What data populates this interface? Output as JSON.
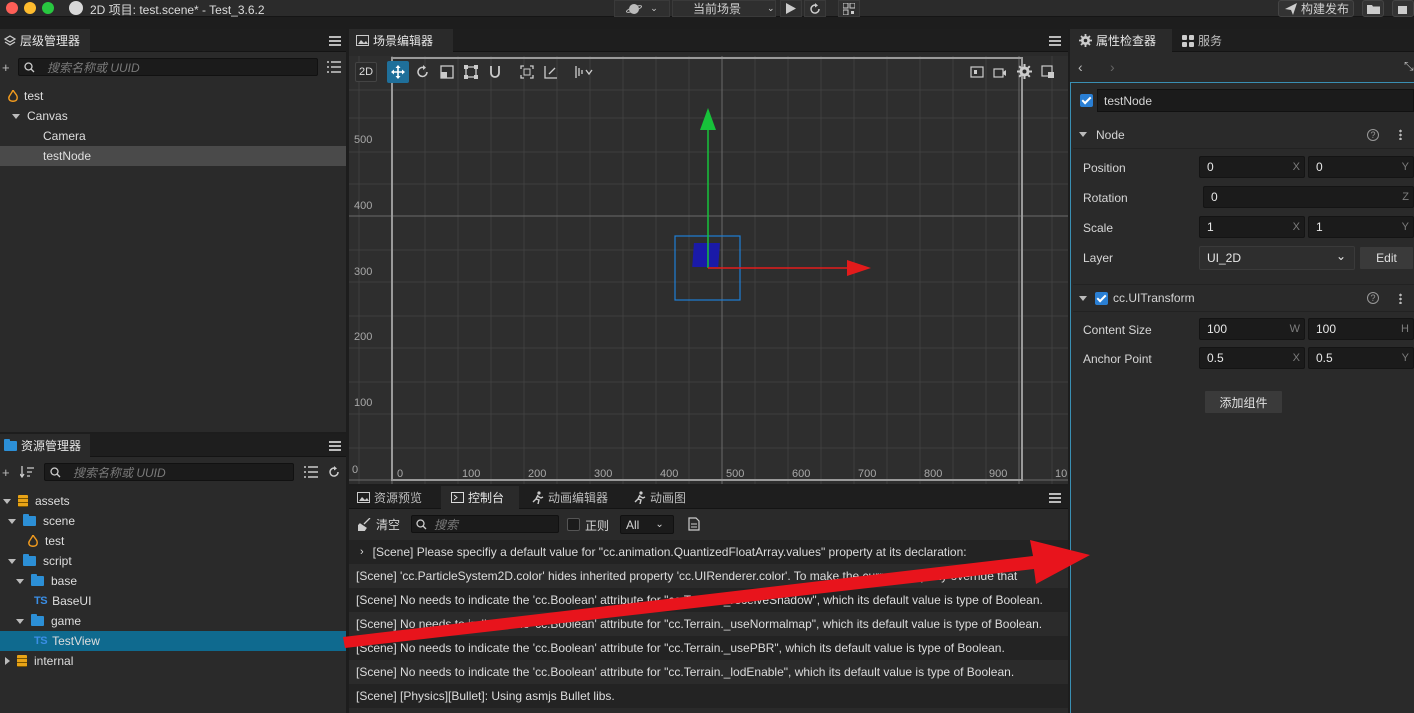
{
  "titlebar": {
    "title": "2D 项目: test.scene* - Test_3.6.2",
    "scene_select": "当前场景",
    "build_label": "构建发布"
  },
  "hierarchy": {
    "tab": "层级管理器",
    "search_placeholder": "搜索名称或 UUID",
    "nodes": [
      {
        "label": "test",
        "depth": 0
      },
      {
        "label": "Canvas",
        "depth": 1
      },
      {
        "label": "Camera",
        "depth": 2
      },
      {
        "label": "testNode",
        "depth": 2,
        "selected": true
      }
    ]
  },
  "scene": {
    "tab": "场景编辑器",
    "mode_2d": "2D",
    "y_ticks": [
      "500",
      "400",
      "300",
      "200",
      "100",
      "0"
    ],
    "x_ticks": [
      "0",
      "100",
      "200",
      "300",
      "400",
      "500",
      "600",
      "700",
      "800",
      "900",
      "10"
    ]
  },
  "assets": {
    "tab": "资源管理器",
    "search_placeholder": "搜索名称或 UUID",
    "items": [
      {
        "label": "assets",
        "kind": "db"
      },
      {
        "label": "scene",
        "kind": "folder"
      },
      {
        "label": "test",
        "kind": "scene"
      },
      {
        "label": "script",
        "kind": "folder"
      },
      {
        "label": "base",
        "kind": "folder"
      },
      {
        "label": "BaseUI",
        "kind": "ts"
      },
      {
        "label": "game",
        "kind": "folder"
      },
      {
        "label": "TestView",
        "kind": "ts",
        "selected": true
      },
      {
        "label": "internal",
        "kind": "db"
      }
    ],
    "ts_badge": "TS"
  },
  "bottom": {
    "tabs": [
      "资源预览",
      "控制台",
      "动画编辑器",
      "动画图"
    ],
    "clear_label": "清空",
    "search_placeholder": "搜索",
    "regex_label": "正则",
    "level_select": "All",
    "logs": [
      "[Scene] Please specifiy a default value for \"cc.animation.QuantizedFloatArray.values\" property at its declaration:",
      "[Scene] 'cc.ParticleSystem2D.color' hides inherited property 'cc.UIRenderer.color'. To make the current property override that",
      "[Scene] No needs to indicate the 'cc.Boolean' attribute for \"cc.Terrain._receiveShadow\", which its default value is type of Boolean.",
      "[Scene] No needs to indicate the 'cc.Boolean' attribute for \"cc.Terrain._useNormalmap\", which its default value is type of Boolean.",
      "[Scene] No needs to indicate the 'cc.Boolean' attribute for \"cc.Terrain._usePBR\", which its default value is type of Boolean.",
      "[Scene] No needs to indicate the 'cc.Boolean' attribute for \"cc.Terrain._lodEnable\", which its default value is type of Boolean.",
      "[Scene] [Physics][Bullet]: Using asmjs Bullet libs."
    ]
  },
  "inspector": {
    "tab": "属性检查器",
    "tab2": "服务",
    "node_name": "testNode",
    "node_section": "Node",
    "position_label": "Position",
    "position_x": "0",
    "position_y": "0",
    "rotation_label": "Rotation",
    "rotation_z": "0",
    "scale_label": "Scale",
    "scale_x": "1",
    "scale_y": "1",
    "layer_label": "Layer",
    "layer_value": "UI_2D",
    "edit_label": "Edit",
    "uitransform_section": "cc.UITransform",
    "content_size_label": "Content Size",
    "content_w": "100",
    "content_h": "100",
    "anchor_label": "Anchor Point",
    "anchor_x": "0.5",
    "anchor_y": "0.5",
    "add_component": "添加组件",
    "axis": {
      "x": "X",
      "y": "Y",
      "z": "Z",
      "w": "W",
      "h": "H"
    }
  },
  "colors": {
    "accent": "#2a7fd4",
    "selection_blue": "#0f6a8f",
    "arrow_red": "#e8141c",
    "gizmo_green": "#17c23a"
  }
}
